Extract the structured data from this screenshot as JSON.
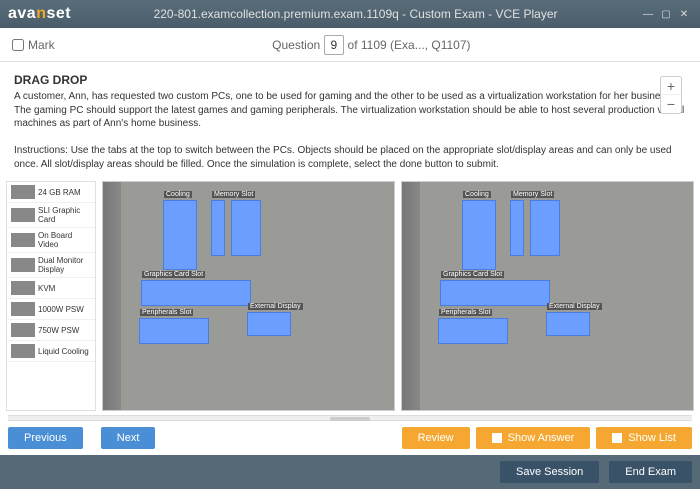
{
  "window": {
    "logo_pre": "ava",
    "logo_n": "n",
    "logo_post": "set",
    "title": "220-801.examcollection.premium.exam.1109q - Custom Exam - VCE Player"
  },
  "qbar": {
    "mark": "Mark",
    "question_label": "Question",
    "current": "9",
    "rest": " of 1109 (Exa..., Q1107)"
  },
  "question": {
    "heading": "DRAG DROP",
    "p1": "A customer, Ann, has requested two custom PCs, one to be used for gaming and the other to be used as a virtualization workstation for her business. The gaming PC should support the latest games and gaming peripherals. The virtualization workstation should be able to host several production virtual machines as part of Ann's home business.",
    "p2": "Instructions: Use the tabs at the top to switch between the PCs. Objects should be placed on the appropriate slot/display areas and can only be used once. All slot/display areas should be filled. Once the simulation is complete, select the done button to submit."
  },
  "zoom": {
    "plus": "+",
    "minus": "−"
  },
  "palette": [
    "24 GB RAM",
    "SLI Graphic Card",
    "On Board Video",
    "Dual Monitor Display",
    "KVM",
    "1000W PSW",
    "750W PSW",
    "Liquid Cooling"
  ],
  "slots": {
    "cooling": "Cooling",
    "memory": "Memory Slot",
    "gfx": "Graphics Card Slot",
    "ext": "External Display",
    "per": "Peripherals Slot"
  },
  "buttons": {
    "previous": "Previous",
    "next": "Next",
    "review": "Review",
    "show_answer": "Show Answer",
    "show_list": "Show List",
    "save_session": "Save Session",
    "end_exam": "End Exam"
  }
}
